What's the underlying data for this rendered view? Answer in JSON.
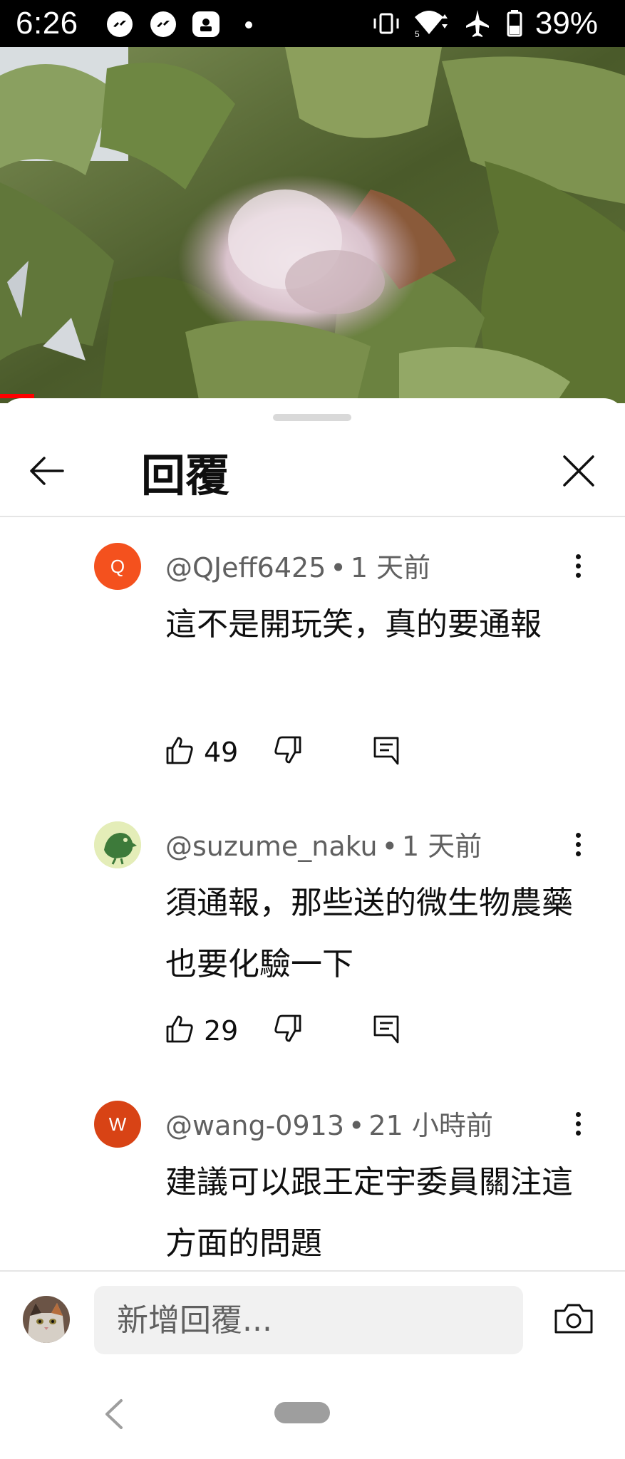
{
  "status_bar": {
    "time": "6:26",
    "battery_percent": "39%",
    "icons": [
      "messenger-icon",
      "messenger-icon",
      "app-notification-icon",
      "vibrate-icon",
      "wifi-icon",
      "airplane-icon",
      "battery-icon"
    ]
  },
  "video": {
    "progress_color": "#ff0000"
  },
  "panel": {
    "title": "回覆",
    "back_icon": "arrow-left-icon",
    "close_icon": "close-icon"
  },
  "comments": [
    {
      "author": "@QJeff6425",
      "time": "1 天前",
      "avatar_letter": "Q",
      "avatar_color": "#f4511e",
      "text": "這不是開玩笑，真的要通報",
      "likes": "49"
    },
    {
      "author": "@suzume_naku",
      "time": "1 天前",
      "avatar_letter": "",
      "avatar_color": "#e8f0c8",
      "text": "須通報，那些送的微生物農藥也要化驗一下",
      "likes": "29"
    },
    {
      "author": "@wang-0913",
      "time": "21 小時前",
      "avatar_letter": "W",
      "avatar_color": "#d84315",
      "text": "建議可以跟王定宇委員關注這方面的問題",
      "likes": ""
    }
  ],
  "composer": {
    "placeholder": "新增回覆..."
  },
  "colors": {
    "text_primary": "#0f0f0f",
    "text_secondary": "#606060",
    "input_bg": "#f1f1f1",
    "divider": "#e5e5e5"
  }
}
